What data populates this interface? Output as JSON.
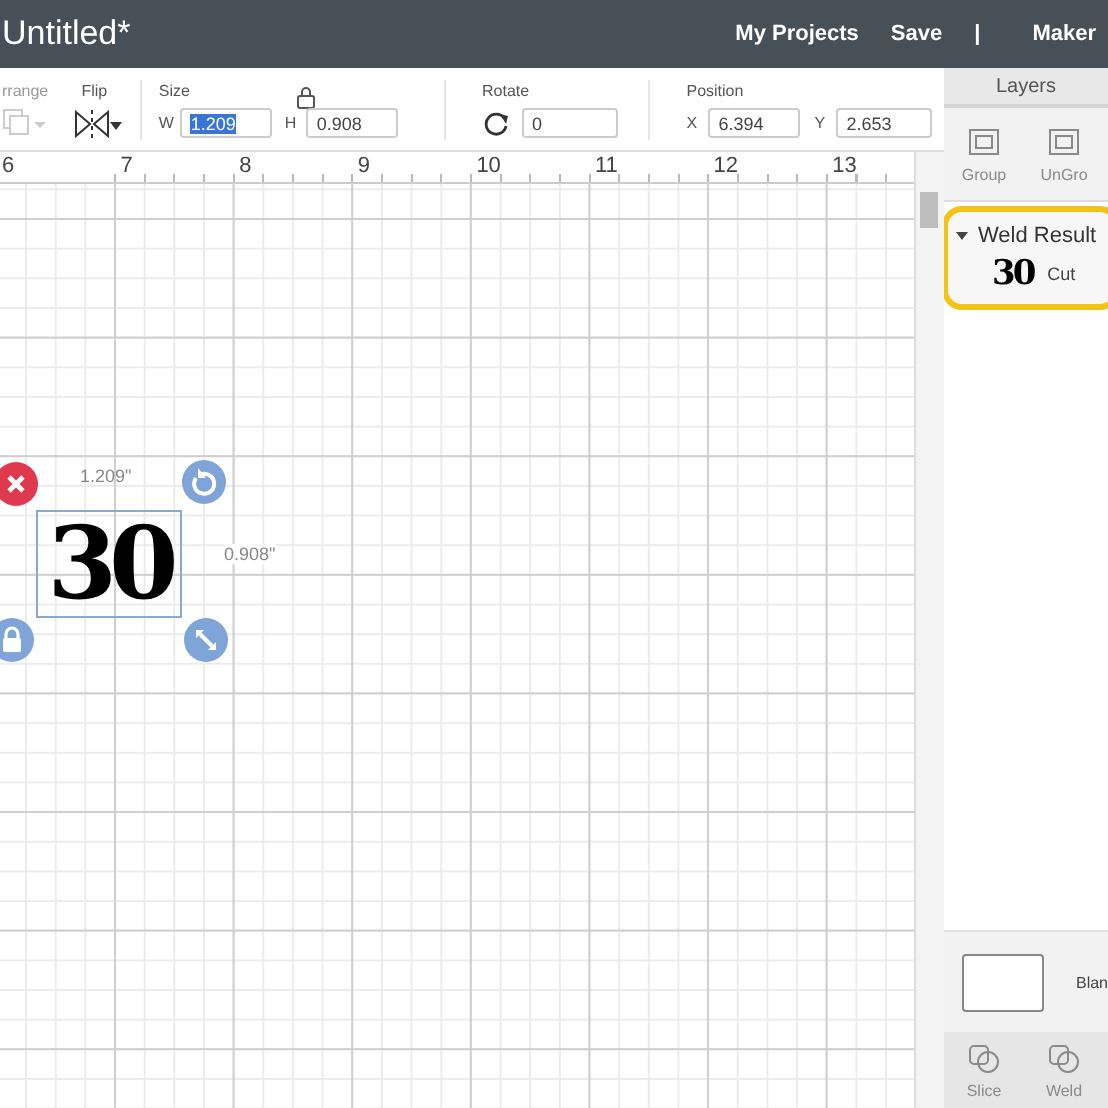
{
  "header": {
    "title": "Untitled*",
    "links": [
      "My Projects",
      "Save",
      "|",
      "Maker"
    ]
  },
  "toolbar": {
    "arrange": {
      "label": "rrange",
      "disabled": true
    },
    "flip": {
      "label": "Flip"
    },
    "size": {
      "label": "Size",
      "w_label": "W",
      "w_value": "1.209",
      "w_selected": true,
      "h_label": "H",
      "h_value": "0.908",
      "locked": true
    },
    "rotate": {
      "label": "Rotate",
      "value": "0"
    },
    "position": {
      "label": "Position",
      "x_label": "X",
      "x_value": "6.394",
      "y_label": "Y",
      "y_value": "2.653"
    }
  },
  "ruler": [
    "6",
    "7",
    "8",
    "9",
    "10",
    "11",
    "12",
    "13"
  ],
  "canvas": {
    "object_text": "30",
    "width_reading": "1.209\"",
    "height_reading": "0.908\""
  },
  "layers": {
    "title": "Layers",
    "tools": [
      {
        "label": "Group",
        "disabled": true
      },
      {
        "label": "UnGro",
        "disabled": true
      }
    ],
    "items": [
      {
        "name": "Weld Result",
        "expanded": true,
        "selected": true,
        "children": [
          {
            "preview": "30",
            "operation": "Cut"
          }
        ]
      }
    ]
  },
  "blank": {
    "label": "Blan"
  },
  "bottom_tools": [
    {
      "label": "Slice",
      "disabled": true
    },
    {
      "label": "Weld",
      "disabled": true
    }
  ]
}
